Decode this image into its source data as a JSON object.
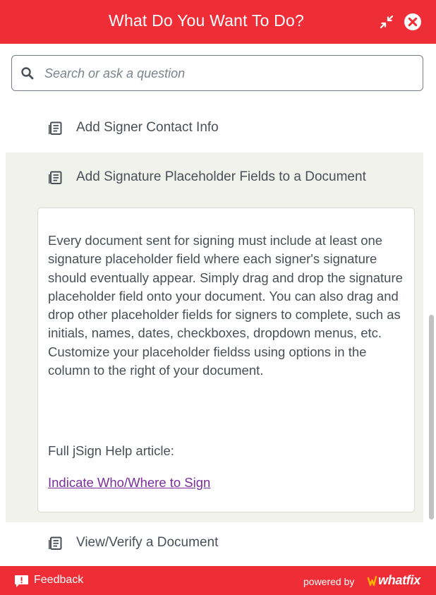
{
  "header": {
    "title": "What Do You Want To Do?",
    "background_color": "#ee2d36"
  },
  "search": {
    "placeholder": "Search or ask a question",
    "value": ""
  },
  "items": [
    {
      "label": "Add Signer Contact Info",
      "icon": "document-list-icon",
      "expanded": false
    },
    {
      "label": "Add Signature Placeholder Fields to a Document",
      "icon": "document-list-icon",
      "expanded": true,
      "body": "Every document sent for signing must include at least one signature placeholder field where each signer's signature should eventually appear. Simply drag and drop the signature placeholder field onto your document. You can also drag and drop other placeholder fields for signers to complete, such as initials, names, dates, checkboxes, dropdown menus, etc. Customize your placeholder fieldss using options in the column to the right of your document.",
      "help_label": "Full jSign Help article:",
      "help_link": "Indicate Who/Where to Sign"
    },
    {
      "label": "View/Verify a Document",
      "icon": "document-list-icon",
      "expanded": false
    }
  ],
  "footer": {
    "feedback_label": "Feedback",
    "powered_by": "powered by",
    "brand": "whatfix"
  },
  "colors": {
    "accent": "#ee2d36",
    "expanded_bg": "#f2f2ed",
    "link": "#7a2f9a",
    "text": "#4a4f57"
  }
}
